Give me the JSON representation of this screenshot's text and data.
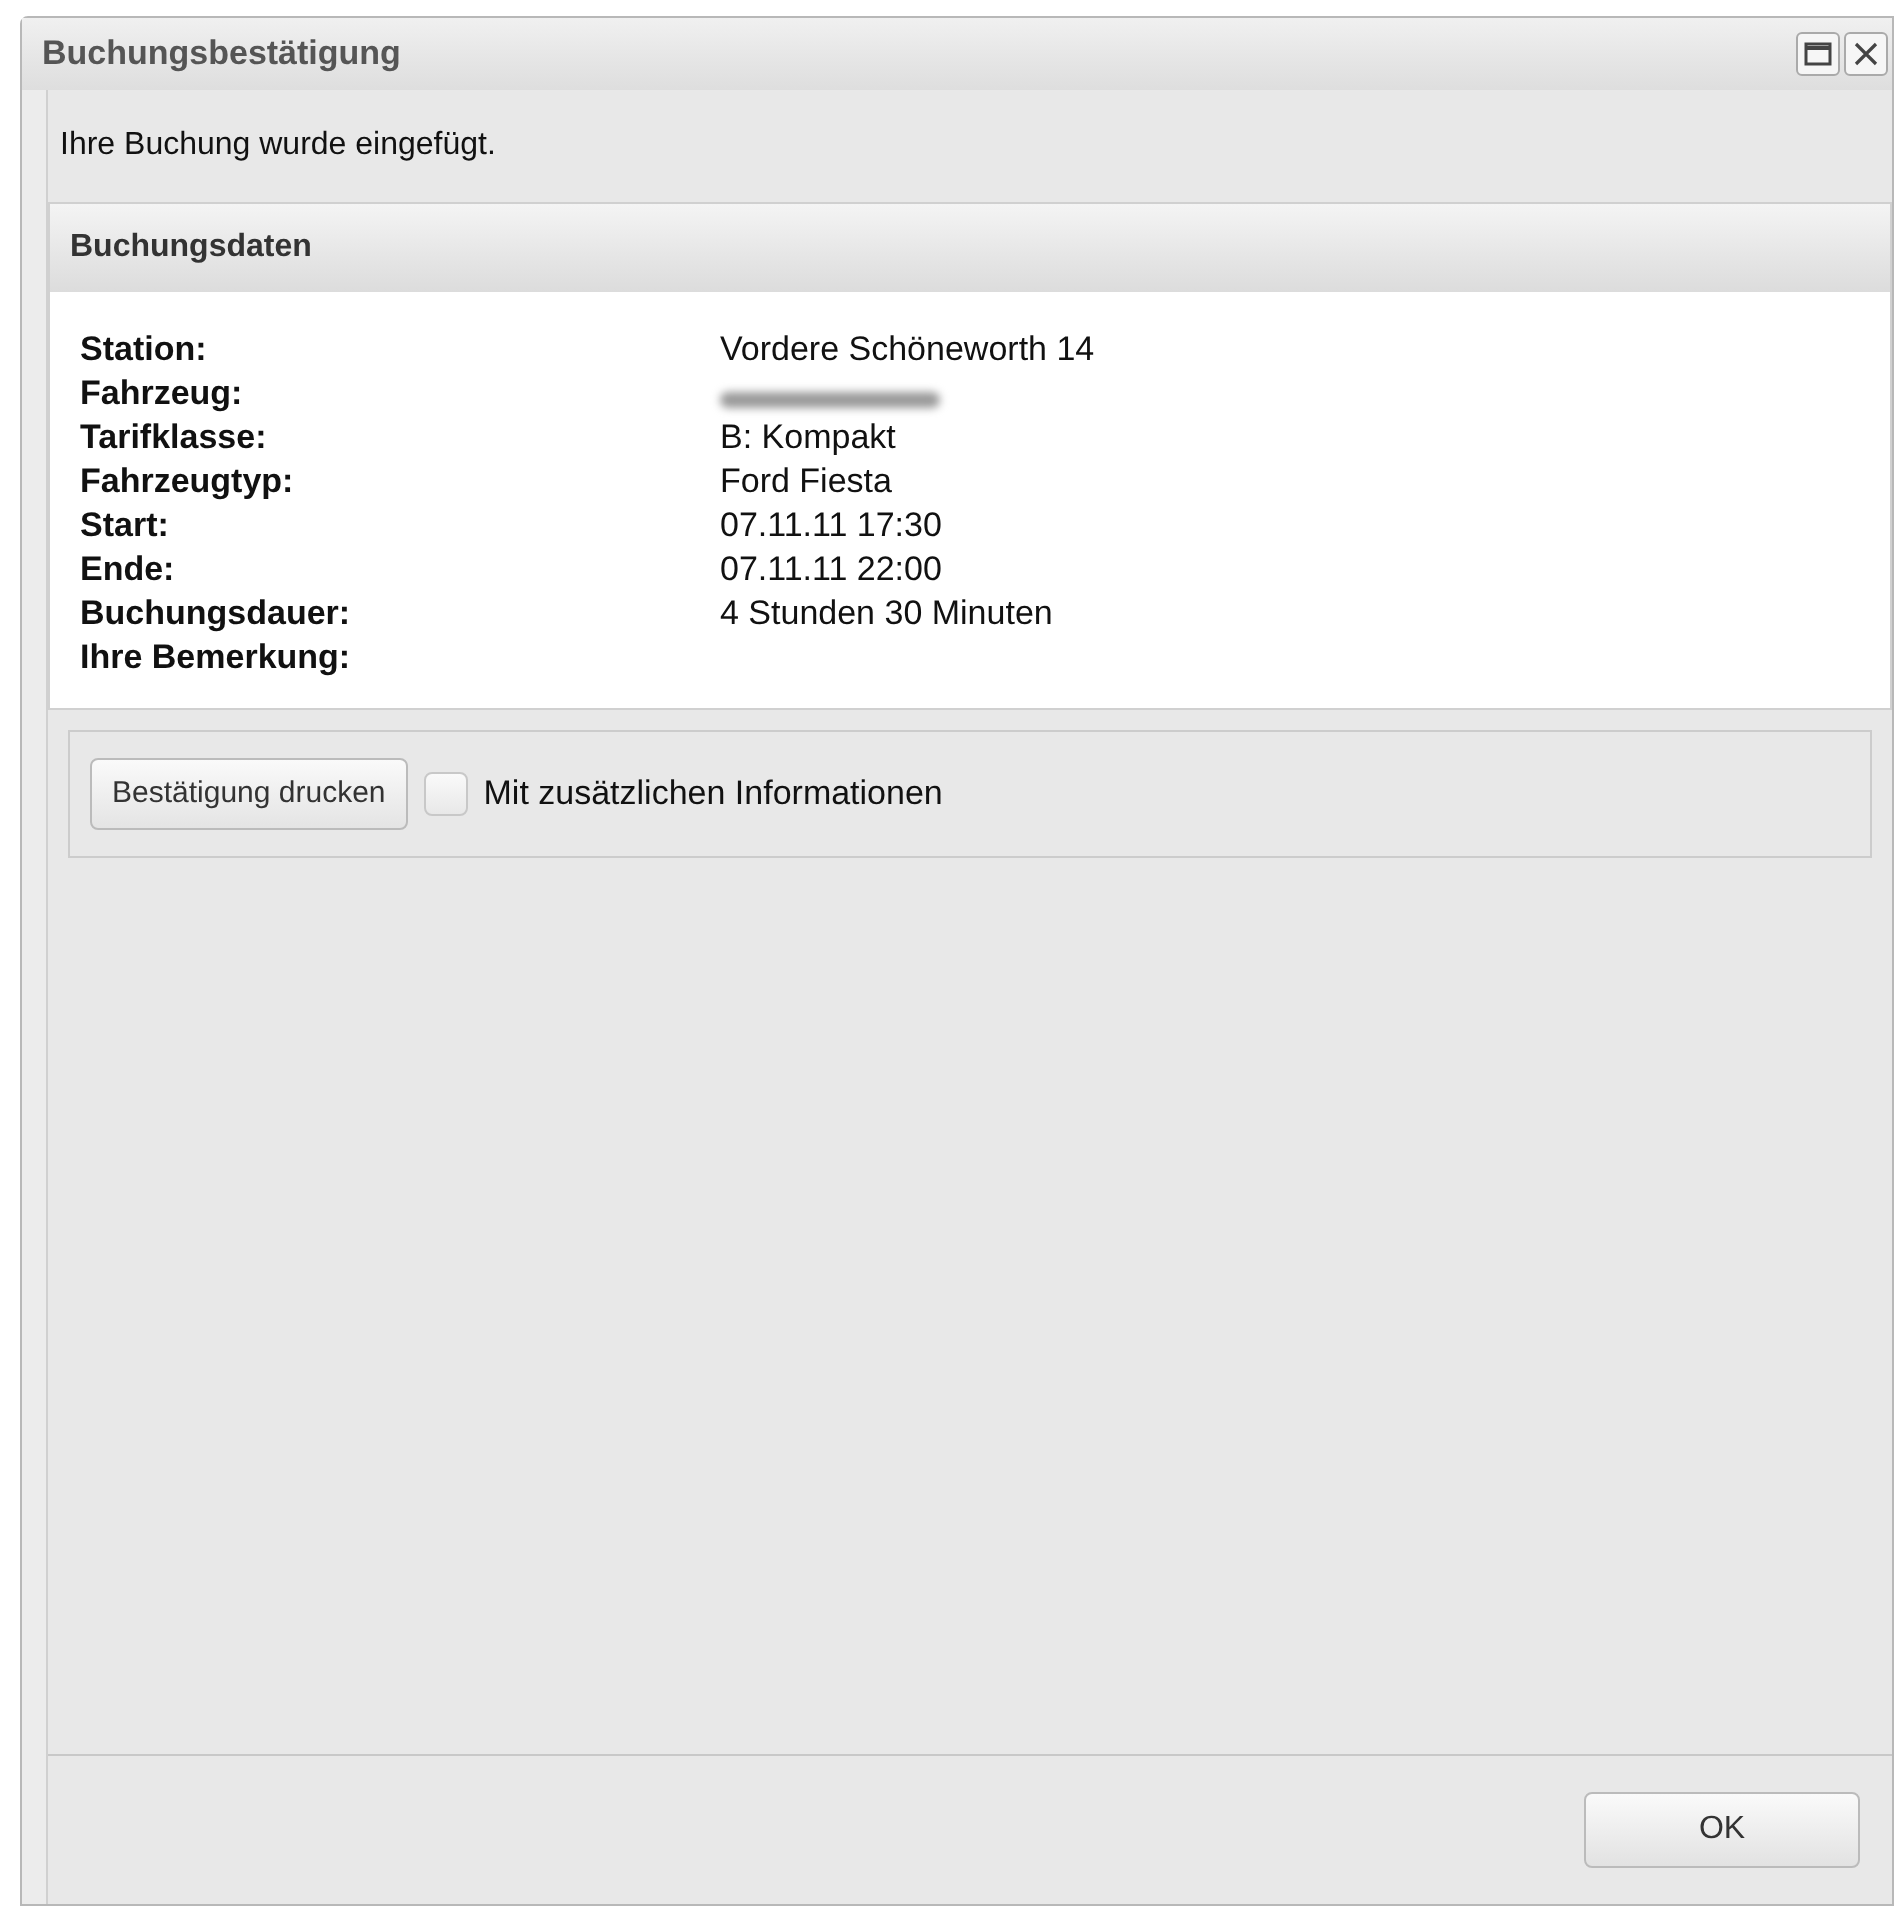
{
  "window": {
    "title": "Buchungsbestätigung"
  },
  "message": "Ihre Buchung wurde eingefügt.",
  "panel": {
    "title": "Buchungsdaten",
    "rows": [
      {
        "label": "Station:",
        "value": "Vordere Schöneworth 14"
      },
      {
        "label": "Fahrzeug:",
        "redacted": true
      },
      {
        "label": "Tarifklasse:",
        "value": "B: Kompakt"
      },
      {
        "label": "Fahrzeugtyp:",
        "value": "Ford Fiesta"
      },
      {
        "label": "Start:",
        "value": "07.11.11 17:30"
      },
      {
        "label": "Ende:",
        "value": "07.11.11 22:00"
      },
      {
        "label": "Buchungsdauer:",
        "value": "4 Stunden 30 Minuten"
      },
      {
        "label": "Ihre Bemerkung:"
      }
    ]
  },
  "print_button": "Bestätigung drucken",
  "extra_info": {
    "label": "Mit zusätzlichen Informationen",
    "checked": false
  },
  "ok_button": "OK"
}
